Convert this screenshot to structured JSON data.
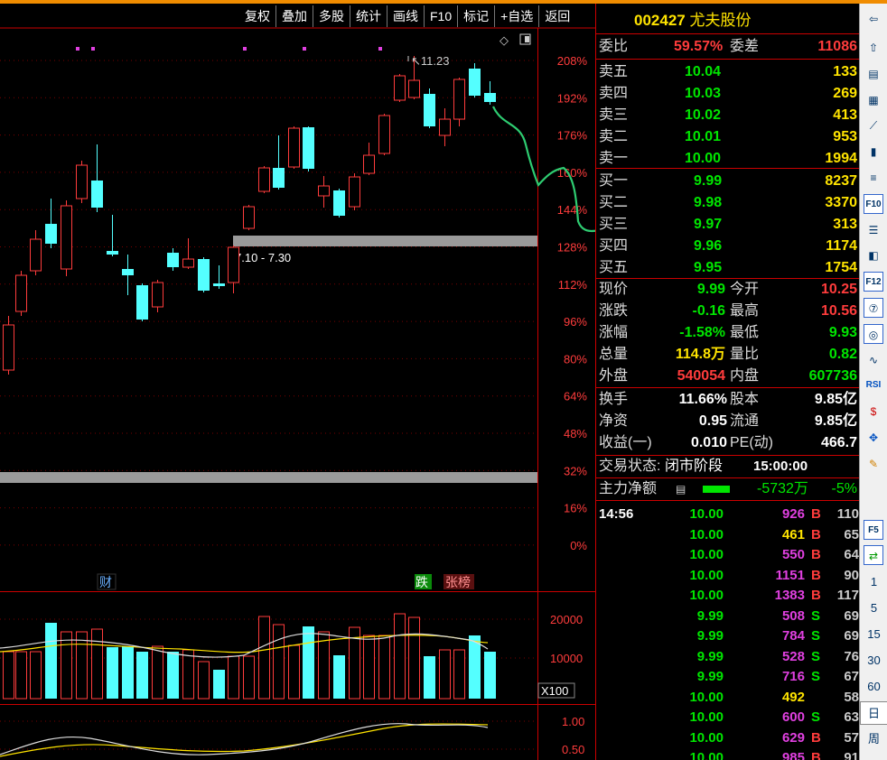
{
  "toolbar": [
    "复权",
    "叠加",
    "多股",
    "统计",
    "画线",
    "F10",
    "标记",
    "+自选",
    "返回"
  ],
  "chart_data": {
    "type": "candlestick",
    "y_axis_labels": [
      "208%",
      "192%",
      "176%",
      "160%",
      "144%",
      "128%",
      "112%",
      "96%",
      "80%",
      "64%",
      "48%",
      "32%",
      "16%",
      "0%"
    ],
    "high_marker": "11.23",
    "band_label": "7.10 - 7.30",
    "event_labels": [
      "财",
      "跌",
      "张榜"
    ],
    "volume_axis": [
      "20000",
      "10000"
    ],
    "volume_unit": "X100",
    "indicator_axis": [
      "1.00",
      "0.50"
    ]
  },
  "quote": {
    "code": "002427",
    "name": "尤夫股份",
    "weibi_label": "委比",
    "weibi": "59.57%",
    "weicha_label": "委差",
    "weicha": "11086",
    "asks": [
      {
        "label": "卖五",
        "price": "10.04",
        "vol": "133"
      },
      {
        "label": "卖四",
        "price": "10.03",
        "vol": "269"
      },
      {
        "label": "卖三",
        "price": "10.02",
        "vol": "413"
      },
      {
        "label": "卖二",
        "price": "10.01",
        "vol": "953"
      },
      {
        "label": "卖一",
        "price": "10.00",
        "vol": "1994"
      }
    ],
    "bids": [
      {
        "label": "买一",
        "price": "9.99",
        "vol": "8237"
      },
      {
        "label": "买二",
        "price": "9.98",
        "vol": "3370"
      },
      {
        "label": "买三",
        "price": "9.97",
        "vol": "313"
      },
      {
        "label": "买四",
        "price": "9.96",
        "vol": "1174"
      },
      {
        "label": "买五",
        "price": "9.95",
        "vol": "1754"
      }
    ],
    "stats": [
      {
        "l1": "现价",
        "v1": "9.99",
        "c1": "green",
        "l2": "今开",
        "v2": "10.25",
        "c2": "red"
      },
      {
        "l1": "涨跌",
        "v1": "-0.16",
        "c1": "green",
        "l2": "最高",
        "v2": "10.56",
        "c2": "red"
      },
      {
        "l1": "涨幅",
        "v1": "-1.58%",
        "c1": "green",
        "l2": "最低",
        "v2": "9.93",
        "c2": "green"
      },
      {
        "l1": "总量",
        "v1": "114.8万",
        "c1": "yellow",
        "l2": "量比",
        "v2": "0.82",
        "c2": "green"
      },
      {
        "l1": "外盘",
        "v1": "540054",
        "c1": "red",
        "l2": "内盘",
        "v2": "607736",
        "c2": "green"
      }
    ],
    "fund": [
      {
        "l1": "换手",
        "v1": "11.66%",
        "l2": "股本",
        "v2": "9.85亿"
      },
      {
        "l1": "净资",
        "v1": "0.95",
        "l2": "流通",
        "v2": "9.85亿"
      },
      {
        "l1": "收益(一)",
        "v1": "0.010",
        "l2": "PE(动)",
        "v2": "466.7"
      }
    ],
    "status_label": "交易状态:",
    "status": "闭市阶段",
    "status_time": "15:00:00",
    "main_label": "主力净额",
    "main_value": "-5732万",
    "main_pct": "-5%"
  },
  "ticks": [
    {
      "time": "14:56",
      "price": "10.00",
      "vol": "926",
      "vc": "magenta",
      "bs": "B",
      "n": "110"
    },
    {
      "time": "",
      "price": "10.00",
      "vol": "461",
      "vc": "yellow",
      "bs": "B",
      "n": "65"
    },
    {
      "time": "",
      "price": "10.00",
      "vol": "550",
      "vc": "magenta",
      "bs": "B",
      "n": "64"
    },
    {
      "time": "",
      "price": "10.00",
      "vol": "1151",
      "vc": "magenta",
      "bs": "B",
      "n": "90"
    },
    {
      "time": "",
      "price": "10.00",
      "vol": "1383",
      "vc": "magenta",
      "bs": "B",
      "n": "117"
    },
    {
      "time": "",
      "price": "9.99",
      "vol": "508",
      "vc": "magenta",
      "bs": "S",
      "n": "69"
    },
    {
      "time": "",
      "price": "9.99",
      "vol": "784",
      "vc": "magenta",
      "bs": "S",
      "n": "69"
    },
    {
      "time": "",
      "price": "9.99",
      "vol": "528",
      "vc": "magenta",
      "bs": "S",
      "n": "76"
    },
    {
      "time": "",
      "price": "9.99",
      "vol": "716",
      "vc": "magenta",
      "bs": "S",
      "n": "67"
    },
    {
      "time": "",
      "price": "10.00",
      "vol": "492",
      "vc": "yellow",
      "bs": "",
      "n": "58"
    },
    {
      "time": "",
      "price": "10.00",
      "vol": "600",
      "vc": "magenta",
      "bs": "S",
      "n": "63"
    },
    {
      "time": "",
      "price": "10.00",
      "vol": "629",
      "vc": "magenta",
      "bs": "B",
      "n": "57"
    },
    {
      "time": "",
      "price": "10.00",
      "vol": "985",
      "vc": "magenta",
      "bs": "B",
      "n": "91"
    }
  ],
  "strip_icons": [
    "up-arrow-icon",
    "report-icon",
    "grid-icon",
    "line-chart-icon",
    "kline-icon",
    "list-icon",
    "f10-icon",
    "news-icon",
    "self-select-icon",
    "f12-icon",
    "f6-icon",
    "circle-icon",
    "wave-icon",
    "rsi-icon",
    "dollar-icon",
    "move-icon",
    "pen-icon"
  ],
  "strip_texts": {
    "f10": "F10",
    "f12": "F12",
    "rsi": "RSI",
    "f5": "F5"
  },
  "periods": [
    "1",
    "5",
    "15",
    "30",
    "60",
    "日",
    "周"
  ]
}
